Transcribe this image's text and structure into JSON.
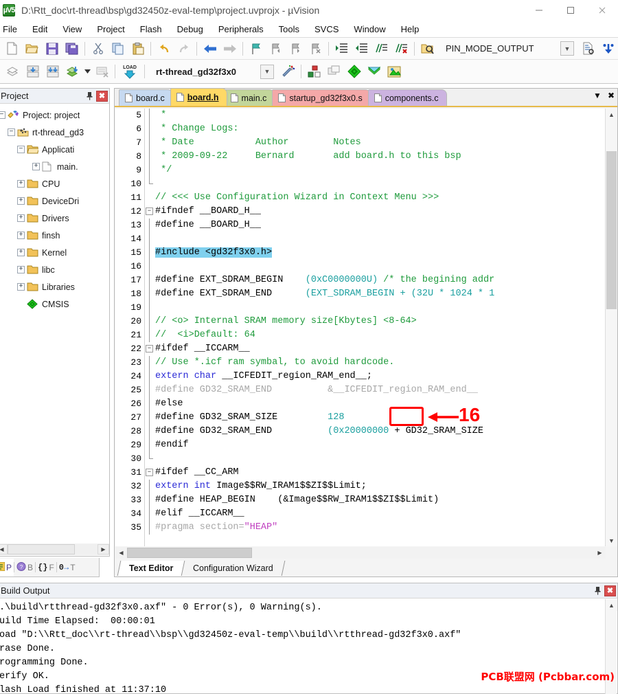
{
  "window": {
    "title": "D:\\Rtt_doc\\rt-thread\\bsp\\gd32450z-eval-temp\\project.uvprojx - µVision",
    "app_icon_label": "µV5",
    "minimize": "minimize-icon",
    "maximize": "maximize-icon",
    "close": "close-icon"
  },
  "menu": {
    "items": [
      "File",
      "Edit",
      "View",
      "Project",
      "Flash",
      "Debug",
      "Peripherals",
      "Tools",
      "SVCS",
      "Window",
      "Help"
    ]
  },
  "toolbar1": {
    "icons": [
      "new-file-icon",
      "open-file-icon",
      "save-icon",
      "save-all-icon",
      "cut-icon",
      "copy-icon",
      "paste-icon",
      "undo-icon",
      "redo-icon",
      "navigate-back-icon",
      "navigate-forward-icon",
      "bookmark-toggle-icon",
      "bookmark-prev-icon",
      "bookmark-next-icon",
      "indent-icon",
      "outdent-icon",
      "comment-icon",
      "uncomment-icon",
      "find-in-files-icon"
    ],
    "combo_value": "PIN_MODE_OUTPUT",
    "combo_arrow": "chevron-down-icon",
    "trailing_icons": [
      "insert-file-icon",
      "debug-icon"
    ]
  },
  "toolbar2": {
    "icons": [
      "translate-icon",
      "build-icon",
      "rebuild-icon",
      "batch-build-icon",
      "batch-build-dropdown-icon",
      "stop-build-icon",
      "load-icon"
    ],
    "project_combo_value": "rt-thread_gd32f3x0",
    "project_combo_arrow": "chevron-down-icon",
    "magic_wand_icon": "target-options-icon",
    "right_icons": [
      "manage-runtime-icon",
      "multi-project-icon",
      "cmsis-pack-icon",
      "pack-installer-icon",
      "manage-project-items-icon"
    ]
  },
  "project_panel": {
    "title": "Project",
    "pin_icon": "pin-icon",
    "close_icon": "close-icon",
    "tree": [
      {
        "indent": 0,
        "expander": "-",
        "icon": "project-icon",
        "label": "Project: project"
      },
      {
        "indent": 1,
        "expander": "-",
        "icon": "target-icon",
        "label": "rt-thread_gd3"
      },
      {
        "indent": 2,
        "expander": "-",
        "icon": "folder-open-icon",
        "label": "Applicati"
      },
      {
        "indent": 3,
        "expander": "+",
        "icon": "file-icon",
        "label": "main."
      },
      {
        "indent": 2,
        "expander": "+",
        "icon": "folder-icon",
        "label": "CPU"
      },
      {
        "indent": 2,
        "expander": "+",
        "icon": "folder-icon",
        "label": "DeviceDri"
      },
      {
        "indent": 2,
        "expander": "+",
        "icon": "folder-icon",
        "label": "Drivers"
      },
      {
        "indent": 2,
        "expander": "+",
        "icon": "folder-icon",
        "label": "finsh"
      },
      {
        "indent": 2,
        "expander": "+",
        "icon": "folder-icon",
        "label": "Kernel"
      },
      {
        "indent": 2,
        "expander": "+",
        "icon": "folder-icon",
        "label": "libc"
      },
      {
        "indent": 2,
        "expander": "+",
        "icon": "folder-icon",
        "label": "Libraries"
      },
      {
        "indent": 2,
        "expander": "",
        "icon": "cmsis-icon",
        "label": "CMSIS"
      }
    ]
  },
  "project_tabs": [
    {
      "label": "P",
      "icon": "project-tab-icon",
      "active": true
    },
    {
      "label": "B",
      "icon": "books-tab-icon",
      "active": false
    },
    {
      "label": "F",
      "icon": "functions-tab-icon",
      "active": false
    },
    {
      "label": "T",
      "icon": "templates-tab-icon",
      "active": false
    }
  ],
  "editor": {
    "tabs": [
      {
        "label": "board.c",
        "color": "#c6d9f0",
        "active": false
      },
      {
        "label": "board.h",
        "color": "#ffd966",
        "active": true
      },
      {
        "label": "main.c",
        "color": "#c2d69b",
        "active": false
      },
      {
        "label": "startup_gd32f3x0.s",
        "color": "#f4a8a8",
        "active": false
      },
      {
        "label": "components.c",
        "color": "#ccb3e0",
        "active": false
      }
    ],
    "tab_menu_icon": "chevron-down-icon",
    "tab_close_icon": "close-icon",
    "bottom_tabs": [
      {
        "label": "Text Editor",
        "active": true
      },
      {
        "label": "Configuration Wizard",
        "active": false
      }
    ],
    "lines": [
      {
        "n": 5,
        "fold": "bar",
        "parts": [
          {
            "t": " *",
            "c": "c-cmt"
          }
        ]
      },
      {
        "n": 6,
        "fold": "bar",
        "parts": [
          {
            "t": " * Change Logs:",
            "c": "c-cmt"
          }
        ]
      },
      {
        "n": 7,
        "fold": "bar",
        "parts": [
          {
            "t": " * Date           Author        Notes",
            "c": "c-cmt"
          }
        ]
      },
      {
        "n": 8,
        "fold": "bar",
        "parts": [
          {
            "t": " * 2009-09-22     Bernard       add board.h to this bsp",
            "c": "c-cmt"
          }
        ]
      },
      {
        "n": 9,
        "fold": "bar",
        "parts": [
          {
            "t": " */",
            "c": "c-cmt"
          }
        ]
      },
      {
        "n": 10,
        "fold": "end",
        "parts": [
          {
            "t": "",
            "c": ""
          }
        ]
      },
      {
        "n": 11,
        "fold": "",
        "parts": [
          {
            "t": "// <<< Use Configuration Wizard in Context Menu >>>",
            "c": "c-cmt"
          }
        ]
      },
      {
        "n": 12,
        "fold": "minus",
        "parts": [
          {
            "t": "#ifndef __BOARD_H__",
            "c": "c-pre"
          }
        ]
      },
      {
        "n": 13,
        "fold": "bar",
        "parts": [
          {
            "t": "#define __BOARD_H__",
            "c": "c-pre"
          }
        ]
      },
      {
        "n": 14,
        "fold": "bar",
        "parts": [
          {
            "t": "",
            "c": ""
          }
        ]
      },
      {
        "n": 15,
        "fold": "bar",
        "parts": [
          {
            "t": "#include <gd32f3x0.h>",
            "c": "c-pre sel"
          }
        ]
      },
      {
        "n": 16,
        "fold": "bar",
        "parts": [
          {
            "t": "",
            "c": ""
          }
        ]
      },
      {
        "n": 17,
        "fold": "bar",
        "parts": [
          {
            "t": "#define EXT_SDRAM_BEGIN    ",
            "c": "c-pre"
          },
          {
            "t": "(0xC0000000U)",
            "c": "c-num"
          },
          {
            "t": " /* the begining addr",
            "c": "c-cmt"
          }
        ]
      },
      {
        "n": 18,
        "fold": "bar",
        "parts": [
          {
            "t": "#define EXT_SDRAM_END      ",
            "c": "c-pre"
          },
          {
            "t": "(EXT_SDRAM_BEGIN + (32U * 1024 * 1",
            "c": "c-num"
          }
        ]
      },
      {
        "n": 19,
        "fold": "bar",
        "parts": [
          {
            "t": "",
            "c": ""
          }
        ]
      },
      {
        "n": 20,
        "fold": "bar",
        "parts": [
          {
            "t": "// <o> Internal SRAM memory size[Kbytes] <8-64>",
            "c": "c-cmt"
          }
        ]
      },
      {
        "n": 21,
        "fold": "bar",
        "parts": [
          {
            "t": "//  <i>Default: 64",
            "c": "c-cmt"
          }
        ]
      },
      {
        "n": 22,
        "fold": "minus",
        "parts": [
          {
            "t": "#ifdef __ICCARM__",
            "c": "c-pre"
          }
        ]
      },
      {
        "n": 23,
        "fold": "bar",
        "parts": [
          {
            "t": "// Use *.icf ram symbal, to avoid hardcode.",
            "c": "c-cmt"
          }
        ]
      },
      {
        "n": 24,
        "fold": "bar",
        "parts": [
          {
            "t": "extern char",
            "c": "c-kw"
          },
          {
            "t": " __ICFEDIT_region_RAM_end__;",
            "c": "c-pre"
          }
        ]
      },
      {
        "n": 25,
        "fold": "bar",
        "parts": [
          {
            "t": "#define GD32_SRAM_END          &__ICFEDIT_region_RAM_end__",
            "c": "c-dis"
          }
        ]
      },
      {
        "n": 26,
        "fold": "bar",
        "parts": [
          {
            "t": "#else",
            "c": "c-pre"
          }
        ]
      },
      {
        "n": 27,
        "fold": "bar",
        "parts": [
          {
            "t": "#define GD32_SRAM_SIZE        ",
            "c": "c-pre"
          },
          {
            "t": " 128",
            "c": "c-num"
          }
        ]
      },
      {
        "n": 28,
        "fold": "bar",
        "parts": [
          {
            "t": "#define GD32_SRAM_END         ",
            "c": "c-pre"
          },
          {
            "t": " (0x20000000",
            "c": "c-num"
          },
          {
            "t": " + GD32_SRAM_SIZE ",
            "c": "c-pre"
          }
        ]
      },
      {
        "n": 29,
        "fold": "bar",
        "parts": [
          {
            "t": "#endif",
            "c": "c-pre"
          }
        ]
      },
      {
        "n": 30,
        "fold": "end",
        "parts": [
          {
            "t": "",
            "c": ""
          }
        ]
      },
      {
        "n": 31,
        "fold": "minus",
        "parts": [
          {
            "t": "#ifdef __CC_ARM",
            "c": "c-pre"
          }
        ]
      },
      {
        "n": 32,
        "fold": "bar",
        "parts": [
          {
            "t": "extern int",
            "c": "c-kw"
          },
          {
            "t": " Image$$RW_IRAM1$$ZI$$Limit;",
            "c": "c-pre"
          }
        ]
      },
      {
        "n": 33,
        "fold": "bar",
        "parts": [
          {
            "t": "#define HEAP_BEGIN    (&Image$$RW_IRAM1$$ZI$$Limit)",
            "c": "c-pre"
          }
        ]
      },
      {
        "n": 34,
        "fold": "bar",
        "parts": [
          {
            "t": "#elif __ICCARM__",
            "c": "c-pre"
          }
        ]
      },
      {
        "n": 35,
        "fold": "bar",
        "parts": [
          {
            "t": "#pragma section=",
            "c": "c-dis"
          },
          {
            "t": "\"HEAP\"",
            "c": "c-str"
          }
        ]
      }
    ]
  },
  "annotation": {
    "boxed_value": "128",
    "arrow_icon": "left-arrow-annotation",
    "number": "16",
    "color": "#ff0000"
  },
  "build_output": {
    "title": "Build Output",
    "pin_icon": "pin-icon",
    "close_icon": "close-icon",
    "lines": [
      ".\\build\\rtthread-gd32f3x0.axf\" - 0 Error(s), 0 Warning(s).",
      "uild Time Elapsed:  00:00:01",
      "oad \"D:\\\\Rtt_doc\\\\rt-thread\\\\bsp\\\\gd32450z-eval-temp\\\\build\\\\rtthread-gd32f3x0.axf\"",
      "rase Done.",
      "rogramming Done.",
      "erify OK.",
      "lash Load finished at 11:37:10"
    ],
    "watermark": "PCB联盟网 (Pcbbar.com)"
  }
}
